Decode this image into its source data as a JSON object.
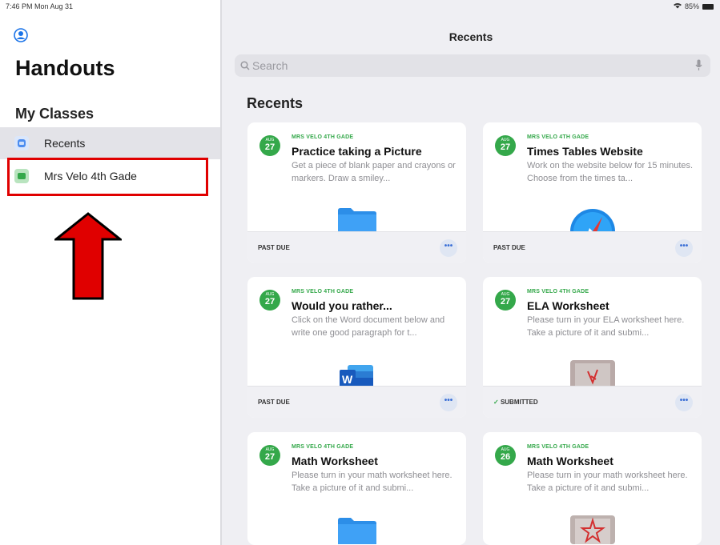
{
  "status_bar": {
    "time": "7:46 PM  Mon Aug 31",
    "battery": "85%"
  },
  "sidebar": {
    "title": "Handouts",
    "section_title": "My Classes",
    "items": [
      {
        "label": "Recents"
      },
      {
        "label": "Mrs Velo 4th Gade"
      }
    ]
  },
  "main": {
    "nav_title": "Recents",
    "search_placeholder": "Search",
    "heading": "Recents"
  },
  "cards": [
    {
      "month": "AUG",
      "day": "27",
      "class": "MRS VELO 4TH GADE",
      "title": "Practice taking a Picture",
      "desc": "Get a piece of blank paper and crayons or markers. Draw a smiley...",
      "status": "PAST DUE",
      "check": "",
      "thumb": "folder"
    },
    {
      "month": "AUG",
      "day": "27",
      "class": "MRS VELO 4TH GADE",
      "title": "Times Tables Website",
      "desc": "Work on the website below for 15 minutes. Choose from the times ta...",
      "status": "PAST DUE",
      "check": "",
      "thumb": "safari"
    },
    {
      "month": "AUG",
      "day": "27",
      "class": "MRS VELO 4TH GADE",
      "title": "Would you rather...",
      "desc": "Click on the Word document below and write one good paragraph for t...",
      "status": "PAST DUE",
      "check": "",
      "thumb": "word"
    },
    {
      "month": "AUG",
      "day": "27",
      "class": "MRS VELO 4TH GADE",
      "title": "ELA Worksheet",
      "desc": "Please turn in your ELA worksheet here. Take a picture of it and submi...",
      "status": "SUBMITTED",
      "check": "✓",
      "thumb": "photo"
    },
    {
      "month": "AUG",
      "day": "27",
      "class": "MRS VELO 4TH GADE",
      "title": "Math Worksheet",
      "desc": "Please turn in your math worksheet here. Take a picture of it and submi...",
      "status": "",
      "check": "",
      "thumb": "folder"
    },
    {
      "month": "AUG",
      "day": "26",
      "class": "MRS VELO 4TH GADE",
      "title": "Math Worksheet",
      "desc": "Please turn in your math worksheet here. Take a picture of it and submi...",
      "status": "",
      "check": "",
      "thumb": "photo-star"
    }
  ],
  "more_label": "•••",
  "colors": {
    "accent_green": "#34a84a",
    "highlight_red": "#e00000",
    "link_blue": "#3b6fd6"
  }
}
